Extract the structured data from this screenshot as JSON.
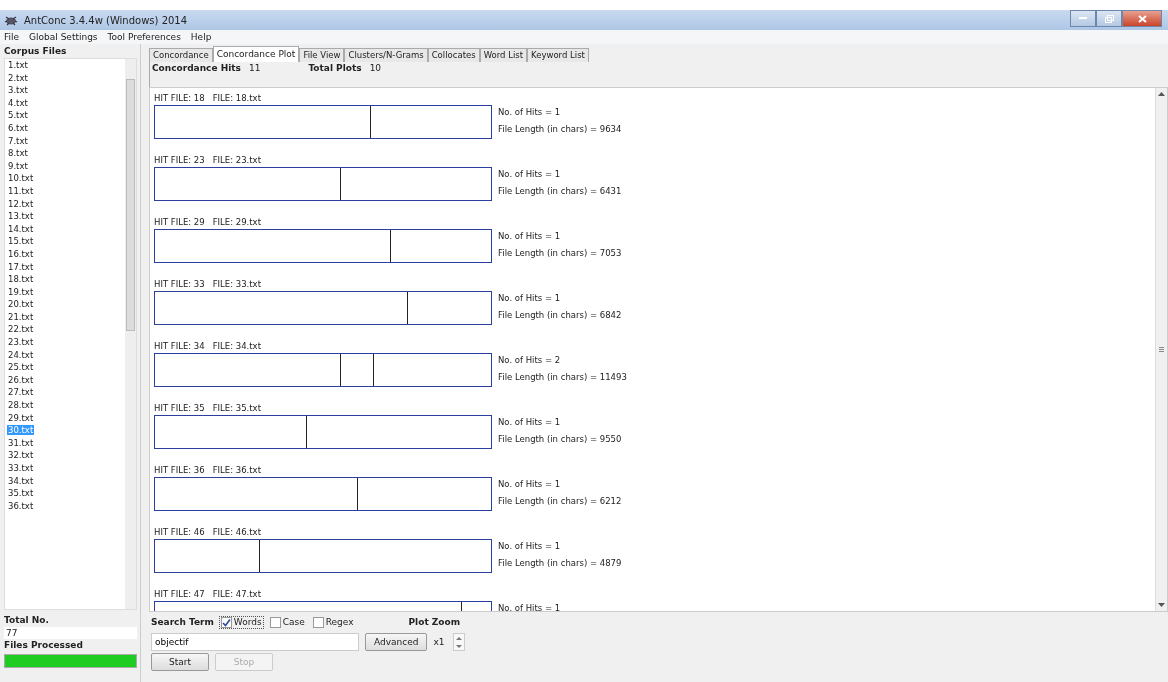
{
  "window": {
    "title": "AntConc 3.4.4w (Windows) 2014"
  },
  "menu": [
    "File",
    "Global Settings",
    "Tool Preferences",
    "Help"
  ],
  "corpus_files": {
    "title": "Corpus Files",
    "items": [
      {
        "name": "1.txt",
        "selected": false
      },
      {
        "name": "2.txt",
        "selected": false
      },
      {
        "name": "3.txt",
        "selected": false
      },
      {
        "name": "4.txt",
        "selected": false
      },
      {
        "name": "5.txt",
        "selected": false
      },
      {
        "name": "6.txt",
        "selected": false
      },
      {
        "name": "7.txt",
        "selected": false
      },
      {
        "name": "8.txt",
        "selected": false
      },
      {
        "name": "9.txt",
        "selected": false
      },
      {
        "name": "10.txt",
        "selected": false
      },
      {
        "name": "11.txt",
        "selected": false
      },
      {
        "name": "12.txt",
        "selected": false
      },
      {
        "name": "13.txt",
        "selected": false
      },
      {
        "name": "14.txt",
        "selected": false
      },
      {
        "name": "15.txt",
        "selected": false
      },
      {
        "name": "16.txt",
        "selected": false
      },
      {
        "name": "17.txt",
        "selected": false
      },
      {
        "name": "18.txt",
        "selected": false
      },
      {
        "name": "19.txt",
        "selected": false
      },
      {
        "name": "20.txt",
        "selected": false
      },
      {
        "name": "21.txt",
        "selected": false
      },
      {
        "name": "22.txt",
        "selected": false
      },
      {
        "name": "23.txt",
        "selected": false
      },
      {
        "name": "24.txt",
        "selected": false
      },
      {
        "name": "25.txt",
        "selected": false
      },
      {
        "name": "26.txt",
        "selected": false
      },
      {
        "name": "27.txt",
        "selected": false
      },
      {
        "name": "28.txt",
        "selected": false
      },
      {
        "name": "29.txt",
        "selected": false
      },
      {
        "name": "30.txt",
        "selected": true
      },
      {
        "name": "31.txt",
        "selected": false
      },
      {
        "name": "32.txt",
        "selected": false
      },
      {
        "name": "33.txt",
        "selected": false
      },
      {
        "name": "34.txt",
        "selected": false
      },
      {
        "name": "35.txt",
        "selected": false
      },
      {
        "name": "36.txt",
        "selected": false
      }
    ],
    "total_label": "Total No.",
    "total": "77",
    "processed_label": "Files Processed",
    "progress": {
      "level": 1
    }
  },
  "tabs": [
    {
      "label": "Concordance",
      "selected": false
    },
    {
      "label": "Concordance Plot",
      "selected": true
    },
    {
      "label": "File View",
      "selected": false
    },
    {
      "label": "Clusters/N-Grams",
      "selected": false
    },
    {
      "label": "Collocates",
      "selected": false
    },
    {
      "label": "Word List",
      "selected": false
    },
    {
      "label": "Keyword List",
      "selected": false
    }
  ],
  "summary": {
    "hits_label": "Concordance Hits",
    "hits": "11",
    "plots_label": "Total Plots",
    "plots": "10"
  },
  "plots": [
    {
      "hit_file": "HIT FILE: 18",
      "file": "FILE: 18.txt",
      "hits_text": "No. of Hits = 1",
      "length_text": "File Length (in chars) = 9634",
      "markers": [
        {
          "level": 0.64
        }
      ]
    },
    {
      "hit_file": "HIT FILE: 23",
      "file": "FILE: 23.txt",
      "hits_text": "No. of Hits = 1",
      "length_text": "File Length (in chars) = 6431",
      "markers": [
        {
          "level": 0.55
        }
      ]
    },
    {
      "hit_file": "HIT FILE: 29",
      "file": "FILE: 29.txt",
      "hits_text": "No. of Hits = 1",
      "length_text": "File Length (in chars) = 7053",
      "markers": [
        {
          "level": 0.7
        }
      ]
    },
    {
      "hit_file": "HIT FILE: 33",
      "file": "FILE: 33.txt",
      "hits_text": "No. of Hits = 1",
      "length_text": "File Length (in chars) = 6842",
      "markers": [
        {
          "level": 0.75
        }
      ]
    },
    {
      "hit_file": "HIT FILE: 34",
      "file": "FILE: 34.txt",
      "hits_text": "No. of Hits = 2",
      "length_text": "File Length (in chars) = 11493",
      "markers": [
        {
          "level": 0.55
        },
        {
          "level": 0.65
        }
      ]
    },
    {
      "hit_file": "HIT FILE: 35",
      "file": "FILE: 35.txt",
      "hits_text": "No. of Hits = 1",
      "length_text": "File Length (in chars) = 9550",
      "markers": [
        {
          "level": 0.45
        }
      ]
    },
    {
      "hit_file": "HIT FILE: 36",
      "file": "FILE: 36.txt",
      "hits_text": "No. of Hits = 1",
      "length_text": "File Length (in chars) = 6212",
      "markers": [
        {
          "level": 0.6
        }
      ]
    },
    {
      "hit_file": "HIT FILE: 46",
      "file": "FILE: 46.txt",
      "hits_text": "No. of Hits = 1",
      "length_text": "File Length (in chars) = 4879",
      "markers": [
        {
          "level": 0.31
        }
      ]
    },
    {
      "hit_file": "HIT FILE: 47",
      "file": "FILE: 47.txt",
      "hits_text": "No. of Hits = 1",
      "markers": [
        {
          "level": 0.91
        }
      ]
    }
  ],
  "search": {
    "label": "Search Term",
    "options": [
      {
        "label": "Words",
        "checked": true
      },
      {
        "label": "Case",
        "checked": false
      },
      {
        "label": "Regex",
        "checked": false
      }
    ],
    "value": "objectif",
    "advanced": "Advanced",
    "zoom_label": "Plot Zoom",
    "zoom": "x1"
  },
  "buttons": [
    {
      "label": "Start",
      "disabled": false
    },
    {
      "label": "Stop",
      "disabled": true
    }
  ]
}
